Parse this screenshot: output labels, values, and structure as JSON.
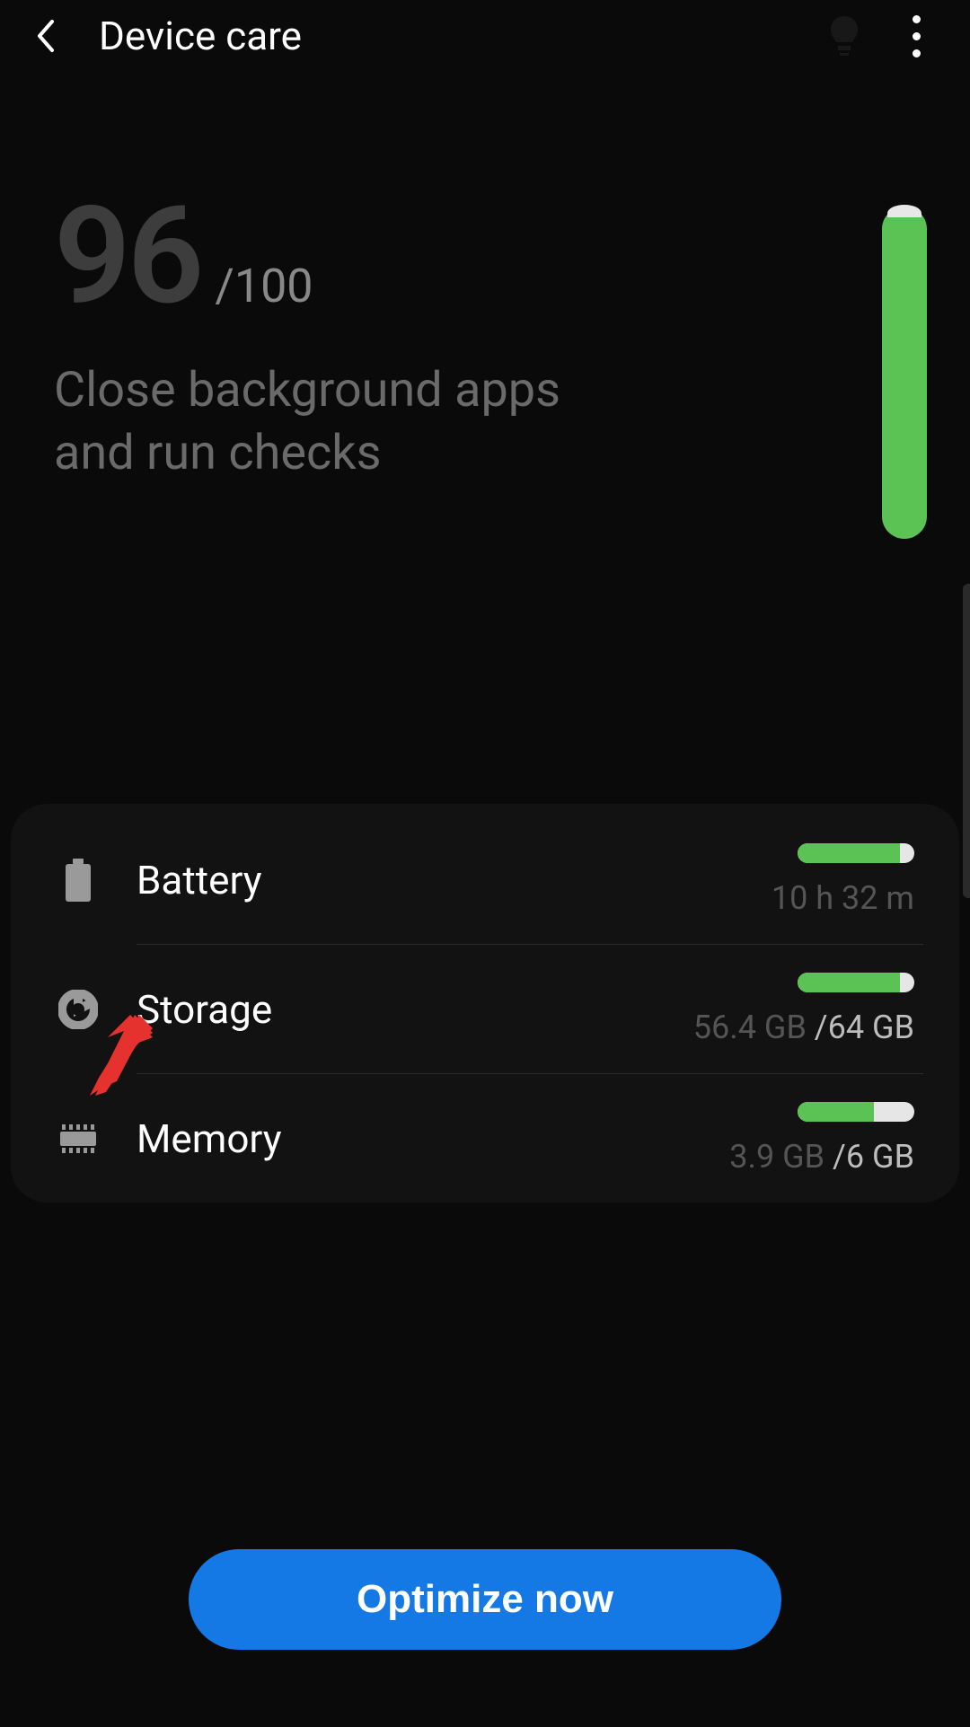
{
  "header": {
    "title": "Device care"
  },
  "score": {
    "value": "96",
    "max": "/100",
    "message": "Close background apps and run checks",
    "bar_fill_pct": 96
  },
  "rows": {
    "battery": {
      "label": "Battery",
      "sub": "10 h 32 m",
      "fill_pct": 88
    },
    "storage": {
      "label": "Storage",
      "used": "56.4 GB ",
      "total": "/64 GB",
      "fill_pct": 88
    },
    "memory": {
      "label": "Memory",
      "used": "3.9 GB ",
      "total": "/6 GB",
      "fill_pct": 65
    }
  },
  "button": {
    "optimize": "Optimize now"
  },
  "colors": {
    "accent_green": "#5bc254",
    "accent_blue": "#1478e5",
    "arrow_red": "#e5322e"
  }
}
